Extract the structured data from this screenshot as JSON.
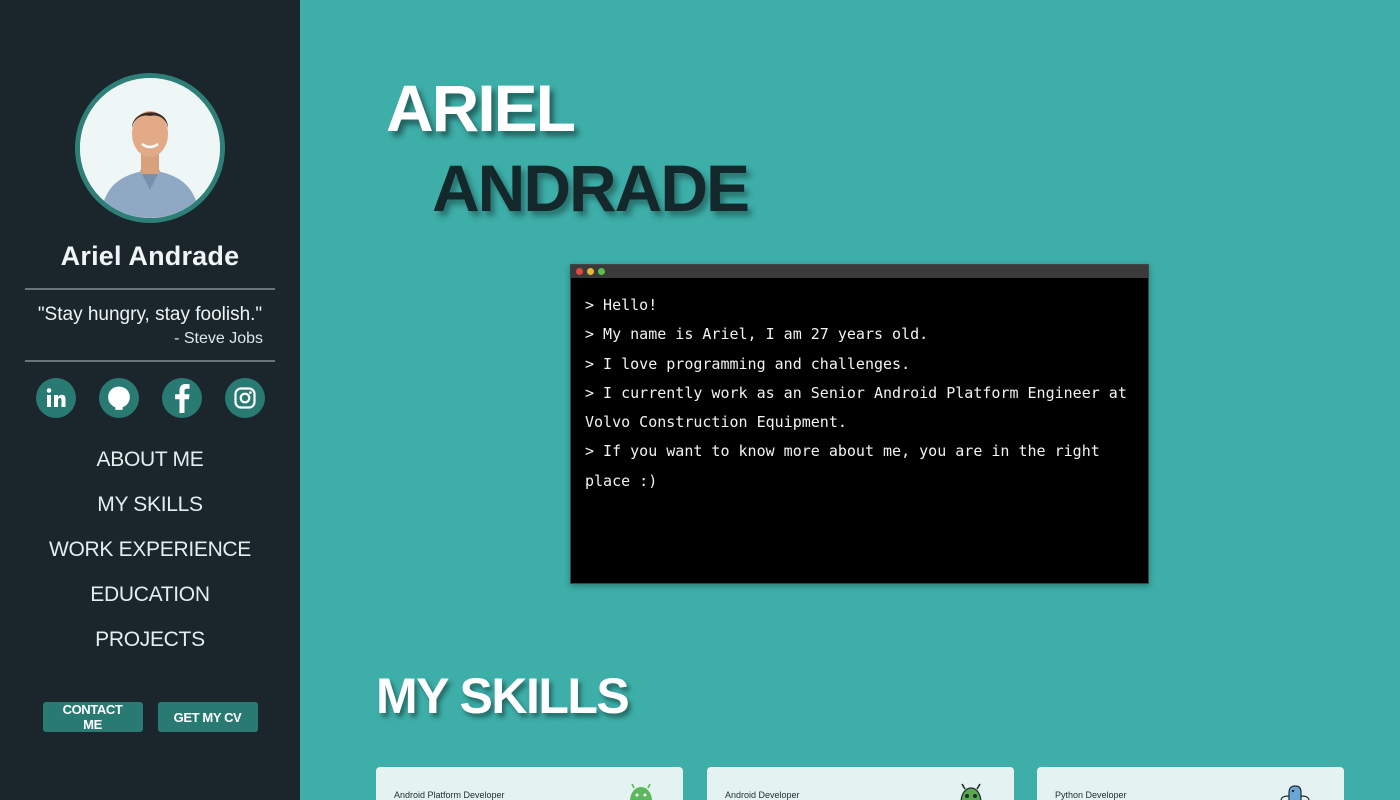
{
  "sidebar": {
    "name": "Ariel Andrade",
    "quote": "\"Stay hungry, stay foolish.\"",
    "quote_author": "- Steve Jobs",
    "socials": [
      "linkedin-icon",
      "github-icon",
      "facebook-icon",
      "instagram-icon"
    ],
    "nav": [
      "ABOUT ME",
      "MY SKILLS",
      "WORK EXPERIENCE",
      "EDUCATION",
      "PROJECTS"
    ],
    "contact_label": "CONTACT ME",
    "cv_label": "GET MY CV"
  },
  "hero": {
    "first_name": "ARIEL",
    "last_name": "ANDRADE"
  },
  "terminal": {
    "lines": [
      "> Hello!",
      "> My name is Ariel, I am 27 years old.",
      "> I love programming and challenges.",
      "> I currently work as an Senior Android Platform Engineer at Volvo Construction Equipment.",
      "> If you want to know more about me, you are in the right place :)"
    ]
  },
  "skills": {
    "title": "MY SKILLS",
    "cards": [
      {
        "label": "Android Platform Developer",
        "icon": "android-icon"
      },
      {
        "label": "Android Developer",
        "icon": "android-robot-icon"
      },
      {
        "label": "Python Developer",
        "icon": "python-icon"
      }
    ]
  },
  "colors": {
    "background": "#3daea8",
    "sidebar": "#1a252c",
    "accent": "#2a7a74"
  }
}
